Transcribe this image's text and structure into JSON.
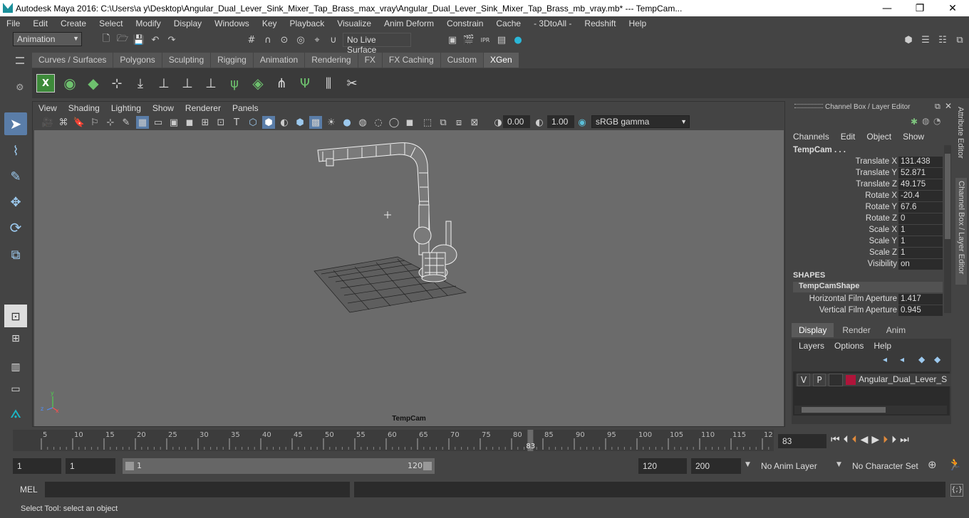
{
  "window": {
    "title": "Autodesk Maya 2016: C:\\Users\\a y\\Desktop\\Angular_Dual_Lever_Sink_Mixer_Tap_Brass_max_vray\\Angular_Dual_Lever_Sink_Mixer_Tap_Brass_mb_vray.mb*   ---   TempCam...",
    "minimize": "—",
    "maximize": "❐",
    "close": "✕"
  },
  "menubar": [
    "File",
    "Edit",
    "Create",
    "Select",
    "Modify",
    "Display",
    "Windows",
    "Key",
    "Playback",
    "Visualize",
    "Anim Deform",
    "Constrain",
    "Cache",
    "- 3DtoAll -",
    "Redshift",
    "Help"
  ],
  "statusline": {
    "mode": "Animation",
    "live_surface": "No Live Surface"
  },
  "shelf": {
    "tabs": [
      "Curves / Surfaces",
      "Polygons",
      "Sculpting",
      "Rigging",
      "Animation",
      "Rendering",
      "FX",
      "FX Caching",
      "Custom",
      "XGen"
    ],
    "active_tab": "XGen"
  },
  "panel": {
    "menus": [
      "View",
      "Shading",
      "Lighting",
      "Show",
      "Renderer",
      "Panels"
    ],
    "exposure": "0.00",
    "gamma": "1.00",
    "color_space": "sRGB gamma",
    "camera_label": "TempCam"
  },
  "channel_box": {
    "header": "Channel Box / Layer Editor",
    "menus": [
      "Channels",
      "Edit",
      "Object",
      "Show"
    ],
    "object_name": "TempCam . . .",
    "attributes": [
      {
        "name": "Translate X",
        "value": "131.438"
      },
      {
        "name": "Translate Y",
        "value": "52.871"
      },
      {
        "name": "Translate Z",
        "value": "49.175"
      },
      {
        "name": "Rotate X",
        "value": "-20.4"
      },
      {
        "name": "Rotate Y",
        "value": "67.6"
      },
      {
        "name": "Rotate Z",
        "value": "0"
      },
      {
        "name": "Scale X",
        "value": "1"
      },
      {
        "name": "Scale Y",
        "value": "1"
      },
      {
        "name": "Scale Z",
        "value": "1"
      },
      {
        "name": "Visibility",
        "value": "on"
      }
    ],
    "shapes_label": "SHAPES",
    "shape_name": "TempCamShape",
    "shape_attributes": [
      {
        "name": "Horizontal Film Aperture",
        "value": "1.417"
      },
      {
        "name": "Vertical Film Aperture",
        "value": "0.945"
      }
    ]
  },
  "layer_editor": {
    "tabs": [
      "Display",
      "Render",
      "Anim"
    ],
    "active_tab": "Display",
    "menus": [
      "Layers",
      "Options",
      "Help"
    ],
    "layer": {
      "v": "V",
      "p": "P",
      "name": "Angular_Dual_Lever_Sink",
      "color": "#b0143a"
    }
  },
  "side_tabs": [
    "Attribute Editor",
    "Channel Box / Layer Editor"
  ],
  "timeline": {
    "ticks": [
      "5",
      "10",
      "15",
      "20",
      "25",
      "30",
      "35",
      "40",
      "45",
      "50",
      "55",
      "60",
      "65",
      "70",
      "75",
      "80",
      "85",
      "90",
      "95",
      "100",
      "105",
      "110",
      "115",
      "12"
    ],
    "current_marker": "83",
    "current_frame": "83"
  },
  "range": {
    "start_field": "1",
    "playback_start": "1",
    "range_start": "1",
    "range_end": "120",
    "playback_end": "120",
    "end_field": "200",
    "anim_layer": "No Anim Layer",
    "character_set": "No Character Set"
  },
  "command": {
    "language": "MEL"
  },
  "help_line": "Select Tool: select an object",
  "colors": {
    "ui_bg": "#444444",
    "viewport_bg": "#6b6b6b",
    "field_bg": "#2b2b2b",
    "accent": "#1b8f9a"
  }
}
